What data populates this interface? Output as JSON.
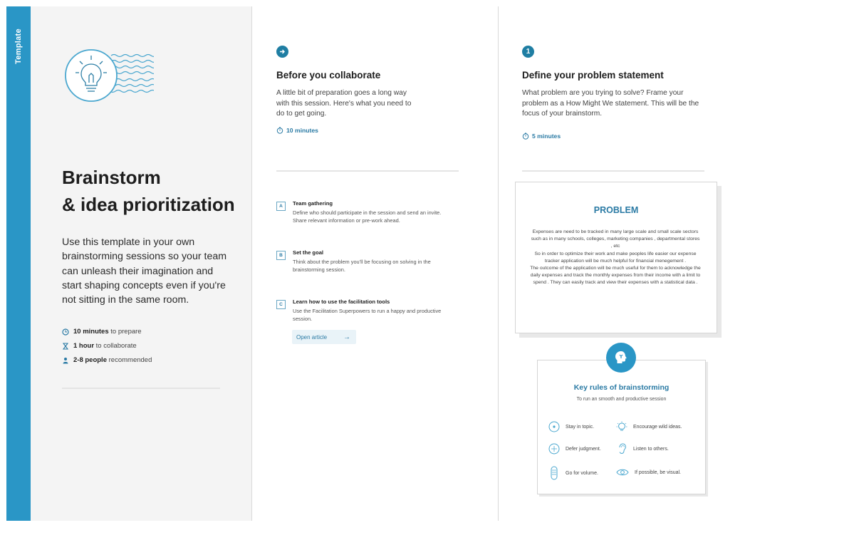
{
  "side_tab": {
    "label": "Template"
  },
  "intro": {
    "title_line1": "Brainstorm",
    "title_line2": "& idea prioritization",
    "description": "Use this template in your own brainstorming sessions so your team can unleash their imagination and start shaping concepts even if you're not sitting in the same room.",
    "meta": [
      {
        "icon": "clock-icon",
        "strong": "10 minutes",
        "rest": " to prepare"
      },
      {
        "icon": "hourglass-icon",
        "strong": "1 hour",
        "rest": " to collaborate"
      },
      {
        "icon": "person-icon",
        "strong": "2-8 people",
        "rest": " recommended"
      }
    ]
  },
  "before": {
    "title": "Before you collaborate",
    "description": "A little bit of preparation goes a long way with this session. Here's what you need to do to get going.",
    "duration": "10 minutes",
    "items": [
      {
        "letter": "A",
        "title": "Team gathering",
        "description": "Define who should participate in the session and send an invite. Share relevant information or pre-work ahead."
      },
      {
        "letter": "B",
        "title": "Set the goal",
        "description": "Think about the problem you'll be focusing on solving in the brainstorming session."
      },
      {
        "letter": "C",
        "title": "Learn how to use the facilitation tools",
        "description": "Use the Facilitation Superpowers to run a happy and productive session."
      }
    ],
    "open_article": "Open article"
  },
  "define": {
    "step_number": "1",
    "title": "Define your problem statement",
    "description": "What problem are you trying to solve? Frame your problem as a How Might We statement. This will be the focus of your brainstorm.",
    "duration": "5 minutes"
  },
  "problem": {
    "title": "PROBLEM",
    "text": "Expenses are need to be tracked in many large scale and small scale sectors such as in many schools, colleges, marketing companies , departmental stores , etc\nSo in order to optimize their work and make peoples life easier our expense tracker application will be much helpful for financial menegement .\nThe outcome of the application will be much useful for them to acknowledge the daily expenses and track the monthly expenses from their income with a limit to spend . They can easily track and view their expenses with a statistical data ."
  },
  "rules": {
    "title": "Key rules of brainstorming",
    "subtitle": "To run an smooth and productive session",
    "items": [
      {
        "icon": "target-icon",
        "label": "Stay in topic."
      },
      {
        "icon": "lightbulb-icon",
        "label": "Encourage wild ideas."
      },
      {
        "icon": "scale-icon",
        "label": "Defer judgment."
      },
      {
        "icon": "ear-icon",
        "label": "Listen to others."
      },
      {
        "icon": "stack-icon",
        "label": "Go for volume."
      },
      {
        "icon": "eye-icon",
        "label": "If possible, be visual."
      }
    ]
  },
  "colors": {
    "accent": "#2a96c6",
    "dark_accent": "#1f7ea3",
    "panel_bg": "#f4f4f4"
  }
}
